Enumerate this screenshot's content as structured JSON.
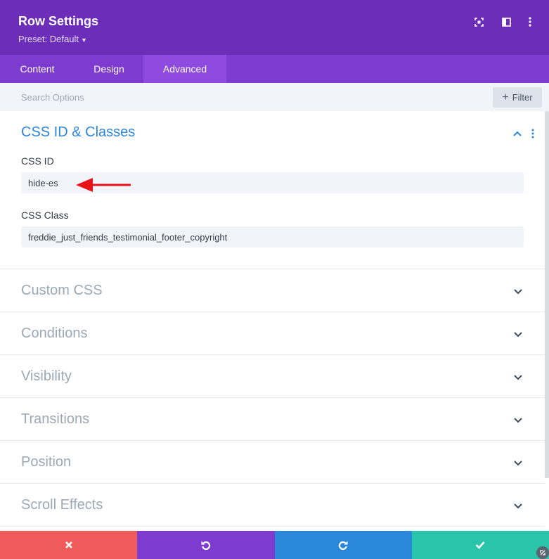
{
  "header": {
    "title": "Row Settings",
    "preset_label": "Preset: Default",
    "icons": [
      "fullscreen-icon",
      "sidebar-toggle-icon",
      "more-options-icon"
    ]
  },
  "tabs": [
    {
      "label": "Content",
      "active": false
    },
    {
      "label": "Design",
      "active": false
    },
    {
      "label": "Advanced",
      "active": true
    }
  ],
  "search": {
    "placeholder": "Search Options",
    "filter_label": "Filter"
  },
  "sections": {
    "css_id_classes": {
      "title": "CSS ID & Classes",
      "expanded": true,
      "css_id_label": "CSS ID",
      "css_id_value": "hide-es",
      "css_class_label": "CSS Class",
      "css_class_value": "freddie_just_friends_testimonial_footer_copyright"
    },
    "collapsed": [
      {
        "title": "Custom CSS"
      },
      {
        "title": "Conditions"
      },
      {
        "title": "Visibility"
      },
      {
        "title": "Transitions"
      },
      {
        "title": "Position"
      },
      {
        "title": "Scroll Effects"
      }
    ]
  },
  "footer": {
    "buttons": [
      {
        "name": "discard",
        "icon": "close-icon",
        "color": "#ef5b5b"
      },
      {
        "name": "undo",
        "icon": "undo-icon",
        "color": "#7d3bcf"
      },
      {
        "name": "redo",
        "icon": "redo-icon",
        "color": "#2b87da"
      },
      {
        "name": "save",
        "icon": "check-icon",
        "color": "#29c4a9"
      }
    ]
  },
  "colors": {
    "header_bg": "#6c2eb9",
    "tabs_bg": "#7e3bd0",
    "active_tab_bg": "#8f4ae0",
    "accent_blue": "#2b87da",
    "annotation_arrow": "#e8141a"
  }
}
